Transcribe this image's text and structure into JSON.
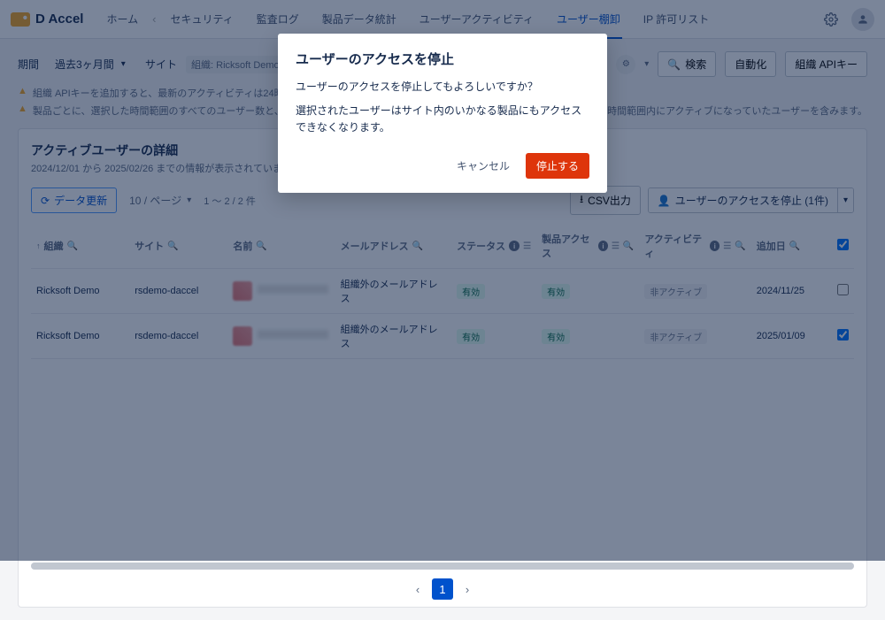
{
  "brand": "D Accel",
  "nav": {
    "home": "ホーム",
    "security": "セキュリティ",
    "audit": "監査ログ",
    "stats": "製品データ統計",
    "user_activity": "ユーザーアクティビティ",
    "user_audit": "ユーザー棚卸",
    "ip_allow": "IP 許可リスト"
  },
  "filters": {
    "period_label": "期間",
    "period_value": "過去3ヶ月間",
    "site_label": "サイト",
    "site_chip": "組織: Ricksoft Demo",
    "search": "検索",
    "automation": "自動化",
    "org_api": "組織 APIキー"
  },
  "warnings": {
    "w1": "組織 APIキーを追加すると、最新のアクティビティは24時間後に開",
    "w2": "製品ごとに、選択した時間範囲のすべてのユーザー数と、これに対",
    "w2_tail": "した時間範囲内にアクティブになっていたユーザーを含みます。"
  },
  "panel": {
    "title": "アクティブユーザーの詳細",
    "subtitle": "2024/12/01 から 2025/02/26 までの情報が表示されています",
    "refresh": "データ更新",
    "per_page": "10 / ページ",
    "range": "1 〜 2 / 2 件",
    "csv": "CSV出力",
    "suspend_btn": "ユーザーのアクセスを停止 (1件)"
  },
  "columns": {
    "org": "組織",
    "site": "サイト",
    "name": "名前",
    "email": "メールアドレス",
    "status": "ステータス",
    "product": "製品アクセス",
    "activity": "アクティビティ",
    "added": "追加日"
  },
  "rows": [
    {
      "org": "Ricksoft Demo",
      "site": "rsdemo-daccel",
      "email": "組織外のメールアドレス",
      "status": "有効",
      "product": "有効",
      "activity": "非アクティブ",
      "added": "2024/11/25",
      "checked": false
    },
    {
      "org": "Ricksoft Demo",
      "site": "rsdemo-daccel",
      "email": "組織外のメールアドレス",
      "status": "有効",
      "product": "有効",
      "activity": "非アクティブ",
      "added": "2025/01/09",
      "checked": true
    }
  ],
  "pager": {
    "current": "1"
  },
  "modal": {
    "title": "ユーザーのアクセスを停止",
    "line1": "ユーザーのアクセスを停止してもよろしいですか？",
    "line2": "選択されたユーザーはサイト内のいかなる製品にもアクセスできなくなります。",
    "cancel": "キャンセル",
    "confirm": "停止する"
  }
}
